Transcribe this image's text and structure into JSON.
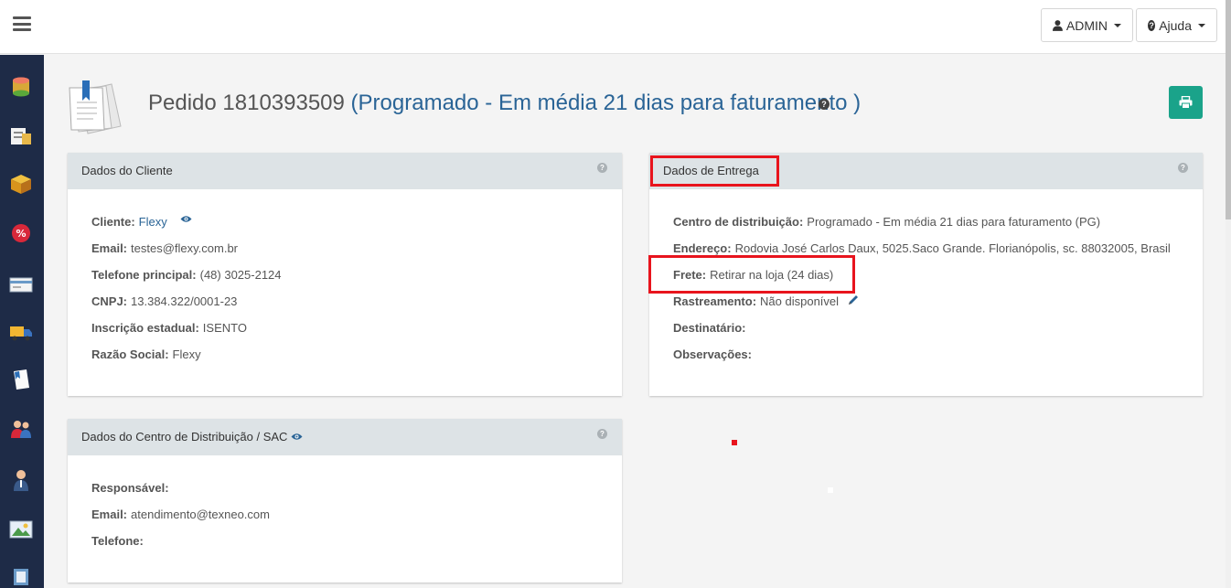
{
  "topbar": {
    "admin_label": "ADMIN",
    "ajuda_label": "Ajuda"
  },
  "sidebar": {
    "items": [
      {
        "icon": "database-icon"
      },
      {
        "icon": "products-icon"
      },
      {
        "icon": "box-icon"
      },
      {
        "icon": "discount-icon"
      },
      {
        "icon": "payment-card-icon"
      },
      {
        "icon": "delivery-truck-icon"
      },
      {
        "icon": "orders-document-icon"
      },
      {
        "icon": "customers-icon"
      },
      {
        "icon": "user-icon"
      },
      {
        "icon": "banner-image-icon"
      },
      {
        "icon": "settings-icon"
      }
    ]
  },
  "page": {
    "title_prefix": "Pedido 1810393509 ",
    "title_status": "(Programado - Em média 21 dias para faturamento )"
  },
  "cliente": {
    "heading": "Dados do Cliente",
    "rows": [
      {
        "label": "Cliente:",
        "value": "Flexy"
      },
      {
        "label": "Email:",
        "value": "testes@flexy.com.br"
      },
      {
        "label": "Telefone principal:",
        "value": "(48) 3025-2124"
      },
      {
        "label": "CNPJ:",
        "value": "13.384.322/0001-23"
      },
      {
        "label": "Inscrição estadual:",
        "value": "ISENTO"
      },
      {
        "label": "Razão Social:",
        "value": "Flexy"
      }
    ]
  },
  "entrega": {
    "heading": "Dados de Entrega",
    "rows": [
      {
        "label": "Centro de distribuição:",
        "value": "Programado - Em média 21 dias para faturamento (PG)"
      },
      {
        "label": "Endereço:",
        "value": "Rodovia José Carlos Daux, 5025.Saco Grande. Florianópolis, sc. 88032005, Brasil"
      },
      {
        "label": "Frete:",
        "value": "Retirar na loja (24 dias)"
      },
      {
        "label": "Rastreamento:",
        "value": "Não disponível"
      },
      {
        "label": "Destinatário:",
        "value": ""
      },
      {
        "label": "Observações:",
        "value": ""
      }
    ]
  },
  "centro": {
    "heading": "Dados do Centro de Distribuição / SAC",
    "rows": [
      {
        "label": "Responsável:",
        "value": ""
      },
      {
        "label": "Email:",
        "value": "atendimento@texneo.com"
      },
      {
        "label": "Telefone:",
        "value": ""
      }
    ]
  },
  "colors": {
    "sidebar": "#1e2b47",
    "link": "#2a6496",
    "print_button": "#1aa38a",
    "highlight": "#e8141d"
  }
}
